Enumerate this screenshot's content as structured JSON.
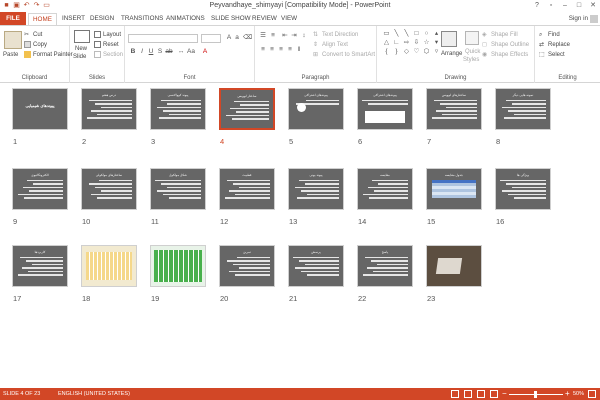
{
  "window": {
    "title": "Peyvandhaye_shimyayi [Compatibility Mode] - PowerPoint"
  },
  "tabs": [
    "FILE",
    "HOME",
    "INSERT",
    "DESIGN",
    "TRANSITIONS",
    "ANIMATIONS",
    "SLIDE SHOW",
    "REVIEW",
    "VIEW"
  ],
  "account": {
    "signin": "Sign in"
  },
  "ribbon": {
    "clipboard": {
      "label": "Clipboard",
      "paste": "Paste",
      "cut": "Cut",
      "copy": "Copy",
      "format_painter": "Format Painter"
    },
    "slides": {
      "label": "Slides",
      "new_slide": "New",
      "new_slide2": "Slide",
      "layout": "Layout",
      "reset": "Reset",
      "section": "Section"
    },
    "font": {
      "label": "Font"
    },
    "paragraph": {
      "label": "Paragraph",
      "text_direction": "Text Direction",
      "align_text": "Align Text",
      "smartart": "Convert to SmartArt"
    },
    "drawing": {
      "label": "Drawing",
      "arrange": "Arrange",
      "quick_styles": "Quick",
      "quick_styles2": "Styles",
      "shape_fill": "Shape Fill",
      "shape_outline": "Shape Outline",
      "shape_effects": "Shape Effects"
    },
    "editing": {
      "label": "Editing",
      "find": "Find",
      "replace": "Replace",
      "select": "Select"
    }
  },
  "slides": [
    {
      "num": "1",
      "title": "پیوندهای شیمیایی",
      "kind": "title"
    },
    {
      "num": "2",
      "title": "درس هفتم",
      "kind": "text"
    },
    {
      "num": "3",
      "title": "پیوند کووالانسی",
      "kind": "text"
    },
    {
      "num": "4",
      "title": "ساختار لوویس",
      "kind": "text"
    },
    {
      "num": "5",
      "title": "پیوندهای اشتراکی",
      "kind": "image"
    },
    {
      "num": "6",
      "title": "پیوندهای اشتراکی",
      "kind": "diagram"
    },
    {
      "num": "7",
      "title": "ساختارهای لوویس",
      "kind": "text"
    },
    {
      "num": "8",
      "title": "نمونه هایی دیگر",
      "kind": "text"
    },
    {
      "num": "9",
      "title": "الکترونگاتیوی",
      "kind": "text"
    },
    {
      "num": "10",
      "title": "ساختارهای مولکولی",
      "kind": "text"
    },
    {
      "num": "11",
      "title": "شکل مولکول",
      "kind": "text"
    },
    {
      "num": "12",
      "title": "قطبیت",
      "kind": "text"
    },
    {
      "num": "13",
      "title": "پیوند یونی",
      "kind": "text"
    },
    {
      "num": "14",
      "title": "مقایسه",
      "kind": "text"
    },
    {
      "num": "15",
      "title": "جدول مقایسه",
      "kind": "table"
    },
    {
      "num": "16",
      "title": "ویژگی ها",
      "kind": "text"
    },
    {
      "num": "17",
      "title": "کاربردها",
      "kind": "text"
    },
    {
      "num": "18",
      "title": "",
      "kind": "periodic"
    },
    {
      "num": "19",
      "title": "",
      "kind": "periodic2"
    },
    {
      "num": "20",
      "title": "تمرین",
      "kind": "text"
    },
    {
      "num": "21",
      "title": "پرسش",
      "kind": "text"
    },
    {
      "num": "22",
      "title": "پاسخ",
      "kind": "text"
    },
    {
      "num": "23",
      "title": "",
      "kind": "photo"
    }
  ],
  "selected_slide": "4",
  "status": {
    "slide_info": "SLIDE 4 OF 23",
    "language": "ENGLISH (UNITED STATES)",
    "zoom": "50%"
  }
}
